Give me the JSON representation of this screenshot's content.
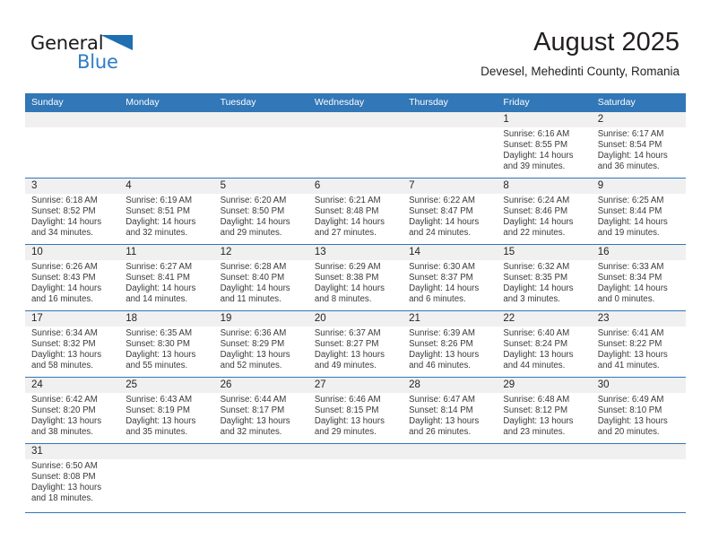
{
  "brand": {
    "name_dark": "General",
    "name_light": "Blue",
    "flag_icon": "blue-triangle-flag-icon"
  },
  "header": {
    "title": "August 2025",
    "subtitle": "Devesel, Mehedinti County, Romania"
  },
  "colors": {
    "header_blue": "#3277b7",
    "brand_blue": "#2e7cc4",
    "daynum_band": "#f0f0f0",
    "text": "#231f20"
  },
  "weekdays": [
    "Sunday",
    "Monday",
    "Tuesday",
    "Wednesday",
    "Thursday",
    "Friday",
    "Saturday"
  ],
  "weeks": [
    [
      {
        "day": "",
        "sunrise": "",
        "sunset": "",
        "daylight_line1": "",
        "daylight_line2": ""
      },
      {
        "day": "",
        "sunrise": "",
        "sunset": "",
        "daylight_line1": "",
        "daylight_line2": ""
      },
      {
        "day": "",
        "sunrise": "",
        "sunset": "",
        "daylight_line1": "",
        "daylight_line2": ""
      },
      {
        "day": "",
        "sunrise": "",
        "sunset": "",
        "daylight_line1": "",
        "daylight_line2": ""
      },
      {
        "day": "",
        "sunrise": "",
        "sunset": "",
        "daylight_line1": "",
        "daylight_line2": ""
      },
      {
        "day": "1",
        "sunrise": "Sunrise: 6:16 AM",
        "sunset": "Sunset: 8:55 PM",
        "daylight_line1": "Daylight: 14 hours",
        "daylight_line2": "and 39 minutes."
      },
      {
        "day": "2",
        "sunrise": "Sunrise: 6:17 AM",
        "sunset": "Sunset: 8:54 PM",
        "daylight_line1": "Daylight: 14 hours",
        "daylight_line2": "and 36 minutes."
      }
    ],
    [
      {
        "day": "3",
        "sunrise": "Sunrise: 6:18 AM",
        "sunset": "Sunset: 8:52 PM",
        "daylight_line1": "Daylight: 14 hours",
        "daylight_line2": "and 34 minutes."
      },
      {
        "day": "4",
        "sunrise": "Sunrise: 6:19 AM",
        "sunset": "Sunset: 8:51 PM",
        "daylight_line1": "Daylight: 14 hours",
        "daylight_line2": "and 32 minutes."
      },
      {
        "day": "5",
        "sunrise": "Sunrise: 6:20 AM",
        "sunset": "Sunset: 8:50 PM",
        "daylight_line1": "Daylight: 14 hours",
        "daylight_line2": "and 29 minutes."
      },
      {
        "day": "6",
        "sunrise": "Sunrise: 6:21 AM",
        "sunset": "Sunset: 8:48 PM",
        "daylight_line1": "Daylight: 14 hours",
        "daylight_line2": "and 27 minutes."
      },
      {
        "day": "7",
        "sunrise": "Sunrise: 6:22 AM",
        "sunset": "Sunset: 8:47 PM",
        "daylight_line1": "Daylight: 14 hours",
        "daylight_line2": "and 24 minutes."
      },
      {
        "day": "8",
        "sunrise": "Sunrise: 6:24 AM",
        "sunset": "Sunset: 8:46 PM",
        "daylight_line1": "Daylight: 14 hours",
        "daylight_line2": "and 22 minutes."
      },
      {
        "day": "9",
        "sunrise": "Sunrise: 6:25 AM",
        "sunset": "Sunset: 8:44 PM",
        "daylight_line1": "Daylight: 14 hours",
        "daylight_line2": "and 19 minutes."
      }
    ],
    [
      {
        "day": "10",
        "sunrise": "Sunrise: 6:26 AM",
        "sunset": "Sunset: 8:43 PM",
        "daylight_line1": "Daylight: 14 hours",
        "daylight_line2": "and 16 minutes."
      },
      {
        "day": "11",
        "sunrise": "Sunrise: 6:27 AM",
        "sunset": "Sunset: 8:41 PM",
        "daylight_line1": "Daylight: 14 hours",
        "daylight_line2": "and 14 minutes."
      },
      {
        "day": "12",
        "sunrise": "Sunrise: 6:28 AM",
        "sunset": "Sunset: 8:40 PM",
        "daylight_line1": "Daylight: 14 hours",
        "daylight_line2": "and 11 minutes."
      },
      {
        "day": "13",
        "sunrise": "Sunrise: 6:29 AM",
        "sunset": "Sunset: 8:38 PM",
        "daylight_line1": "Daylight: 14 hours",
        "daylight_line2": "and 8 minutes."
      },
      {
        "day": "14",
        "sunrise": "Sunrise: 6:30 AM",
        "sunset": "Sunset: 8:37 PM",
        "daylight_line1": "Daylight: 14 hours",
        "daylight_line2": "and 6 minutes."
      },
      {
        "day": "15",
        "sunrise": "Sunrise: 6:32 AM",
        "sunset": "Sunset: 8:35 PM",
        "daylight_line1": "Daylight: 14 hours",
        "daylight_line2": "and 3 minutes."
      },
      {
        "day": "16",
        "sunrise": "Sunrise: 6:33 AM",
        "sunset": "Sunset: 8:34 PM",
        "daylight_line1": "Daylight: 14 hours",
        "daylight_line2": "and 0 minutes."
      }
    ],
    [
      {
        "day": "17",
        "sunrise": "Sunrise: 6:34 AM",
        "sunset": "Sunset: 8:32 PM",
        "daylight_line1": "Daylight: 13 hours",
        "daylight_line2": "and 58 minutes."
      },
      {
        "day": "18",
        "sunrise": "Sunrise: 6:35 AM",
        "sunset": "Sunset: 8:30 PM",
        "daylight_line1": "Daylight: 13 hours",
        "daylight_line2": "and 55 minutes."
      },
      {
        "day": "19",
        "sunrise": "Sunrise: 6:36 AM",
        "sunset": "Sunset: 8:29 PM",
        "daylight_line1": "Daylight: 13 hours",
        "daylight_line2": "and 52 minutes."
      },
      {
        "day": "20",
        "sunrise": "Sunrise: 6:37 AM",
        "sunset": "Sunset: 8:27 PM",
        "daylight_line1": "Daylight: 13 hours",
        "daylight_line2": "and 49 minutes."
      },
      {
        "day": "21",
        "sunrise": "Sunrise: 6:39 AM",
        "sunset": "Sunset: 8:26 PM",
        "daylight_line1": "Daylight: 13 hours",
        "daylight_line2": "and 46 minutes."
      },
      {
        "day": "22",
        "sunrise": "Sunrise: 6:40 AM",
        "sunset": "Sunset: 8:24 PM",
        "daylight_line1": "Daylight: 13 hours",
        "daylight_line2": "and 44 minutes."
      },
      {
        "day": "23",
        "sunrise": "Sunrise: 6:41 AM",
        "sunset": "Sunset: 8:22 PM",
        "daylight_line1": "Daylight: 13 hours",
        "daylight_line2": "and 41 minutes."
      }
    ],
    [
      {
        "day": "24",
        "sunrise": "Sunrise: 6:42 AM",
        "sunset": "Sunset: 8:20 PM",
        "daylight_line1": "Daylight: 13 hours",
        "daylight_line2": "and 38 minutes."
      },
      {
        "day": "25",
        "sunrise": "Sunrise: 6:43 AM",
        "sunset": "Sunset: 8:19 PM",
        "daylight_line1": "Daylight: 13 hours",
        "daylight_line2": "and 35 minutes."
      },
      {
        "day": "26",
        "sunrise": "Sunrise: 6:44 AM",
        "sunset": "Sunset: 8:17 PM",
        "daylight_line1": "Daylight: 13 hours",
        "daylight_line2": "and 32 minutes."
      },
      {
        "day": "27",
        "sunrise": "Sunrise: 6:46 AM",
        "sunset": "Sunset: 8:15 PM",
        "daylight_line1": "Daylight: 13 hours",
        "daylight_line2": "and 29 minutes."
      },
      {
        "day": "28",
        "sunrise": "Sunrise: 6:47 AM",
        "sunset": "Sunset: 8:14 PM",
        "daylight_line1": "Daylight: 13 hours",
        "daylight_line2": "and 26 minutes."
      },
      {
        "day": "29",
        "sunrise": "Sunrise: 6:48 AM",
        "sunset": "Sunset: 8:12 PM",
        "daylight_line1": "Daylight: 13 hours",
        "daylight_line2": "and 23 minutes."
      },
      {
        "day": "30",
        "sunrise": "Sunrise: 6:49 AM",
        "sunset": "Sunset: 8:10 PM",
        "daylight_line1": "Daylight: 13 hours",
        "daylight_line2": "and 20 minutes."
      }
    ],
    [
      {
        "day": "31",
        "sunrise": "Sunrise: 6:50 AM",
        "sunset": "Sunset: 8:08 PM",
        "daylight_line1": "Daylight: 13 hours",
        "daylight_line2": "and 18 minutes."
      },
      {
        "day": "",
        "sunrise": "",
        "sunset": "",
        "daylight_line1": "",
        "daylight_line2": ""
      },
      {
        "day": "",
        "sunrise": "",
        "sunset": "",
        "daylight_line1": "",
        "daylight_line2": ""
      },
      {
        "day": "",
        "sunrise": "",
        "sunset": "",
        "daylight_line1": "",
        "daylight_line2": ""
      },
      {
        "day": "",
        "sunrise": "",
        "sunset": "",
        "daylight_line1": "",
        "daylight_line2": ""
      },
      {
        "day": "",
        "sunrise": "",
        "sunset": "",
        "daylight_line1": "",
        "daylight_line2": ""
      },
      {
        "day": "",
        "sunrise": "",
        "sunset": "",
        "daylight_line1": "",
        "daylight_line2": ""
      }
    ]
  ]
}
